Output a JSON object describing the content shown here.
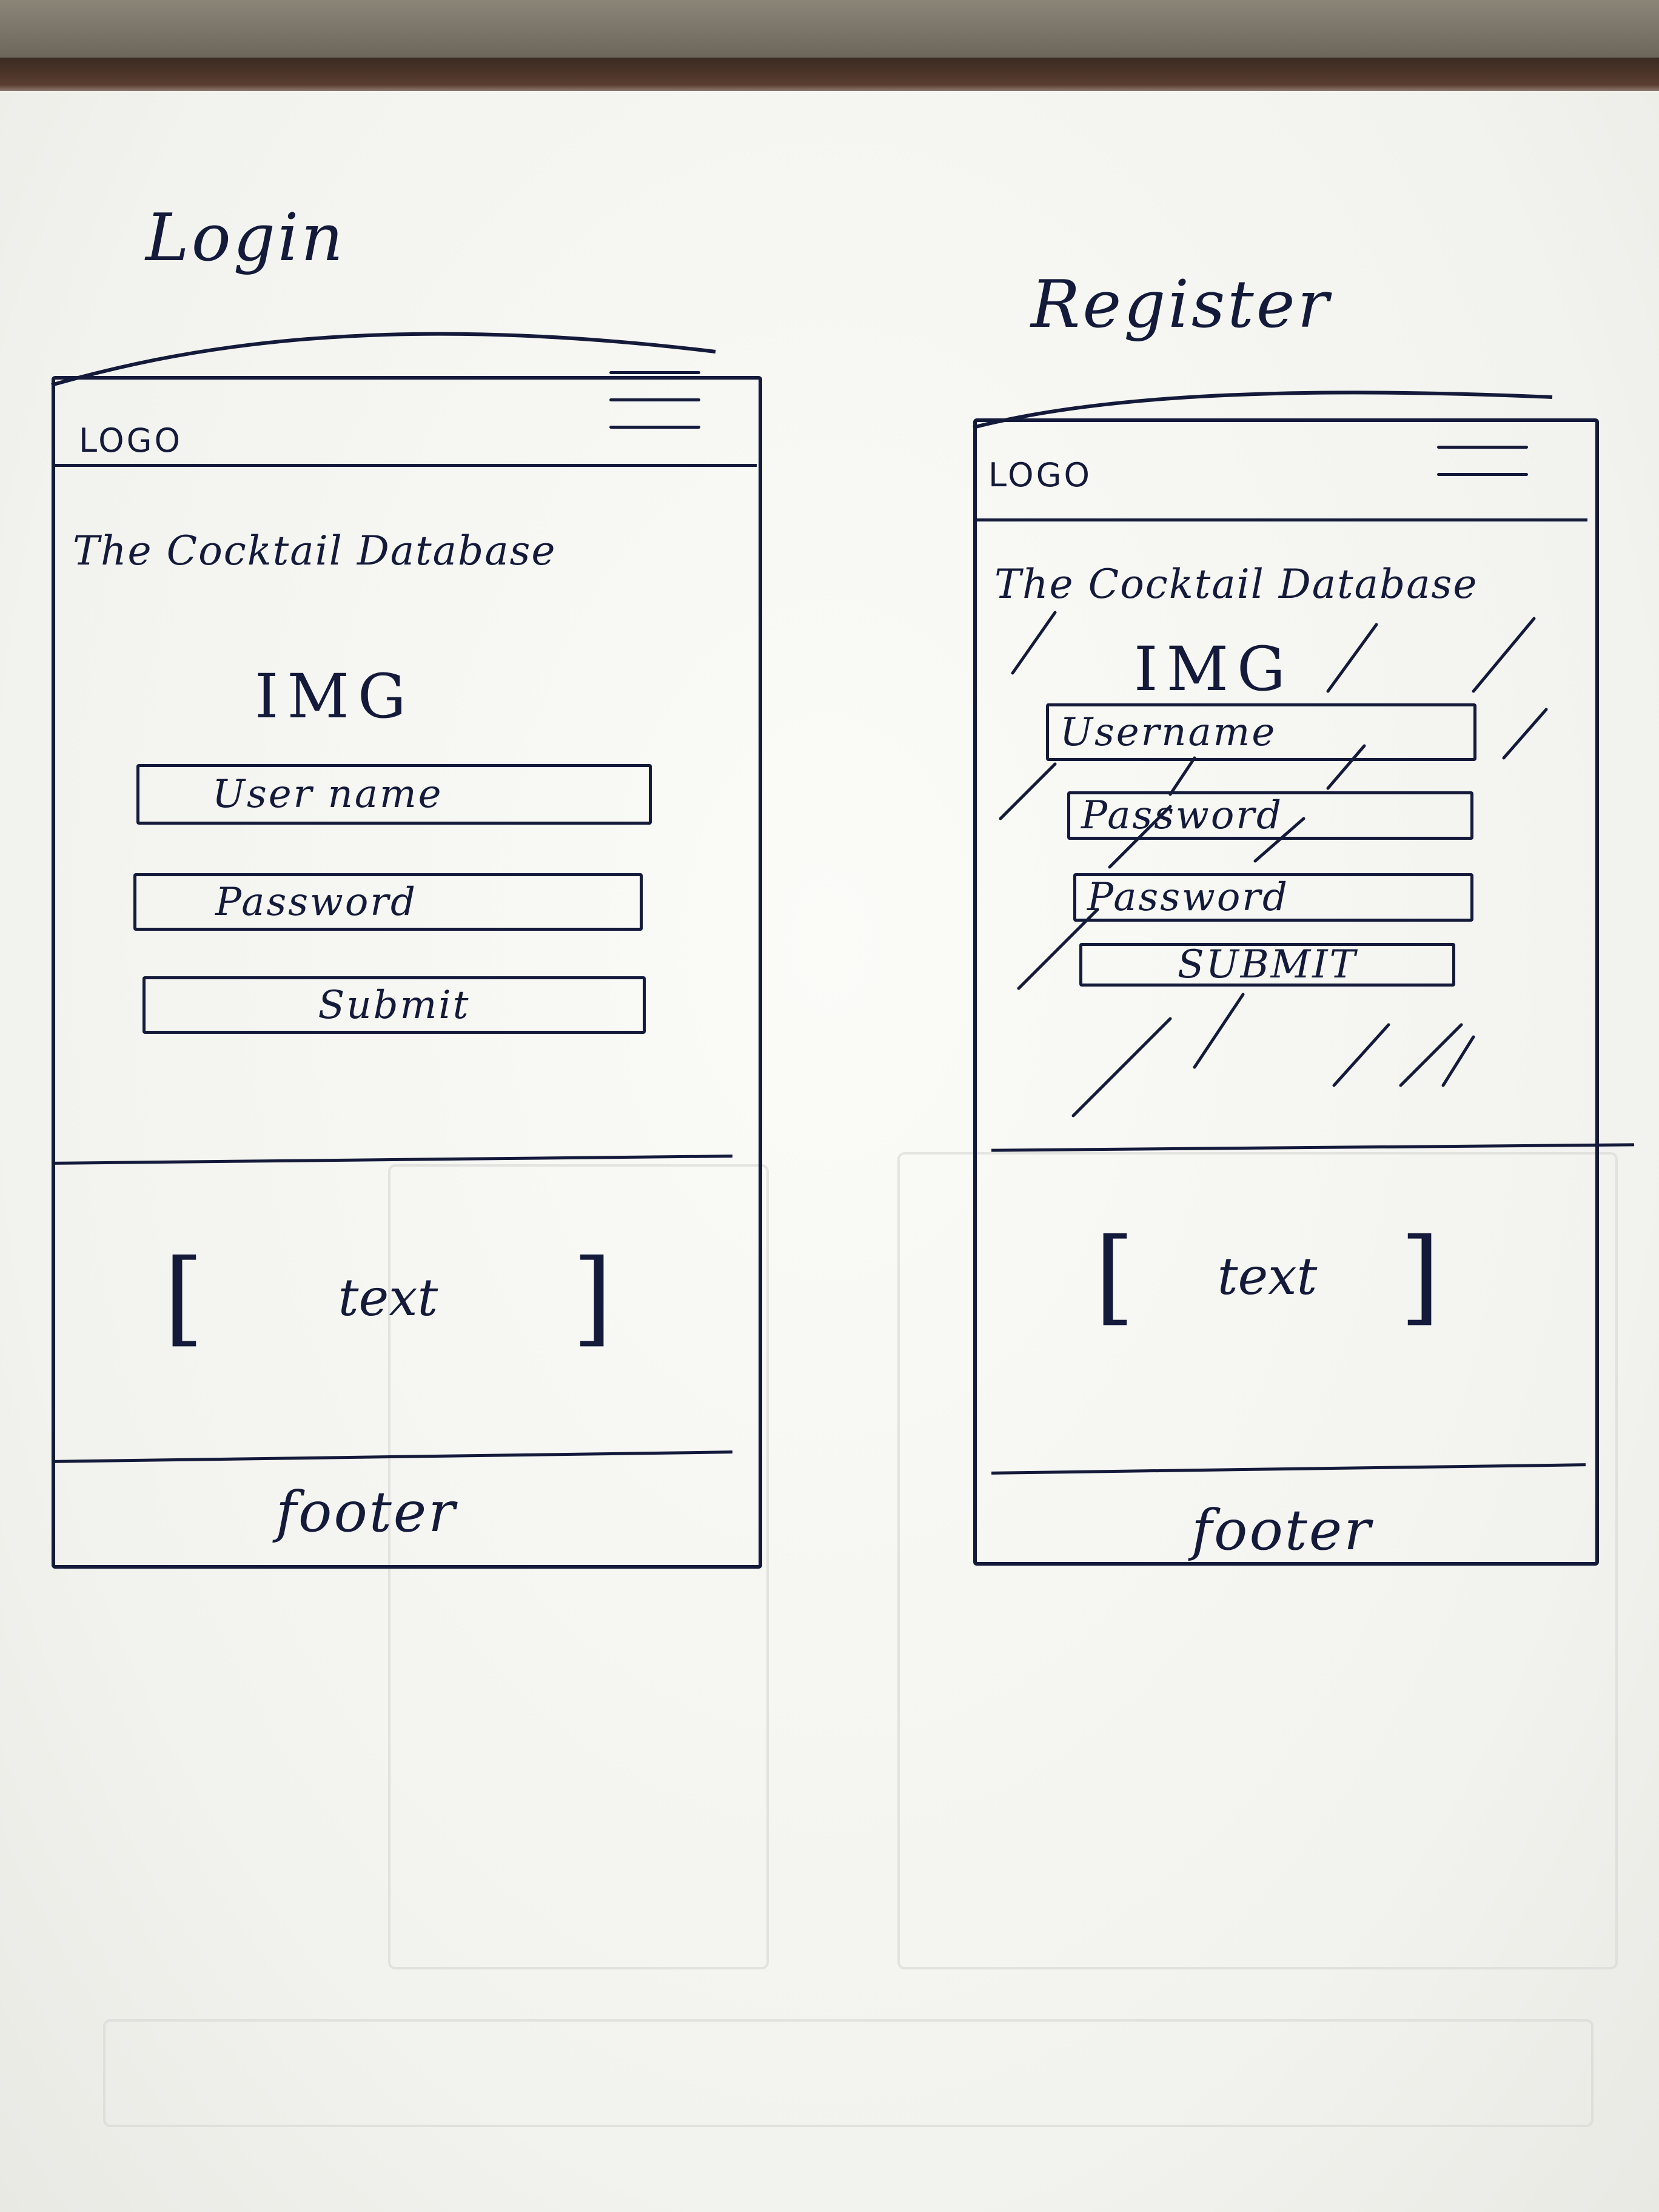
{
  "sketches": [
    {
      "id": "login",
      "title": "Login",
      "header": {
        "logo": "LOGO"
      },
      "main": {
        "heading": "The Cocktail Database",
        "image_placeholder": "IMG",
        "fields": [
          "User name",
          "Password"
        ],
        "submit": "Submit"
      },
      "content": {
        "text": "text",
        "bracket_open": "[",
        "bracket_close": "]"
      },
      "footer": "footer"
    },
    {
      "id": "register",
      "title": "Register",
      "header": {
        "logo": "LOGO"
      },
      "main": {
        "heading": "The Cocktail Database",
        "image_placeholder": "IMG",
        "fields": [
          "Username",
          "Password",
          "Password"
        ],
        "submit": "SUBMIT"
      },
      "content": {
        "text": "text",
        "bracket_open": "[",
        "bracket_close": "]"
      },
      "footer": "footer"
    }
  ],
  "colors": {
    "ink": "#141a3a",
    "paper": "#f3f3ef"
  }
}
